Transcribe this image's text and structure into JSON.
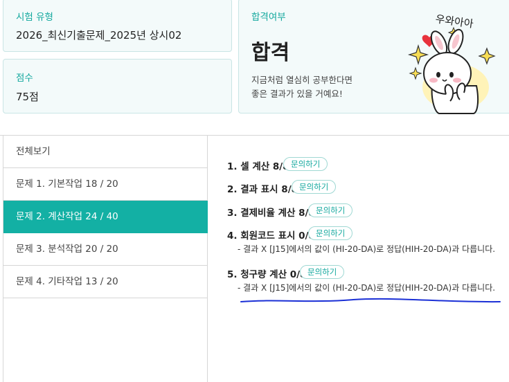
{
  "exam_type": {
    "label": "시험 유형",
    "value": "2026_최신기출문제_2025년 상시02"
  },
  "score": {
    "label": "점수",
    "value": "75점"
  },
  "result": {
    "label": "합격여부",
    "value": "합격",
    "message_line1": "지금처럼 열심히 공부한다면",
    "message_line2": "좋은 결과가 있을 거예요!",
    "mascot_caption": "우와아아"
  },
  "sidebar": {
    "items": [
      {
        "label": "전체보기",
        "active": false
      },
      {
        "label": "문제 1. 기본작업 18 / 20",
        "active": false
      },
      {
        "label": "문제 2. 계산작업 24 / 40",
        "active": true
      },
      {
        "label": "문제 3. 분석작업 20 / 20",
        "active": false
      },
      {
        "label": "문제 4. 기타작업 13 / 20",
        "active": false
      }
    ]
  },
  "questions": [
    {
      "title": "1. 셀 계산 8/8",
      "inquiry": "문의하기",
      "detail": ""
    },
    {
      "title": "2. 결과 표시 8/8",
      "inquiry": "문의하기",
      "detail": ""
    },
    {
      "title": "3. 결제비율 계산 8/8",
      "inquiry": "문의하기",
      "detail": ""
    },
    {
      "title": "4. 회원코드 표시 0/8",
      "inquiry": "문의하기",
      "detail": "- 결과 X [J15]에서의 값이 (HI-20-DA)로 정답(HIH-20-DA)과 다릅니다."
    },
    {
      "title": "5. 청구량 계산 0/8",
      "inquiry": "문의하기",
      "detail": "- 결과 X [J15]에서의 값이 (HI-20-DA)로 정답(HIH-20-DA)과 다릅니다."
    }
  ],
  "colors": {
    "accent": "#13b0a4",
    "card_bg": "#f3fafa",
    "annotation": "#1a2fd6"
  }
}
